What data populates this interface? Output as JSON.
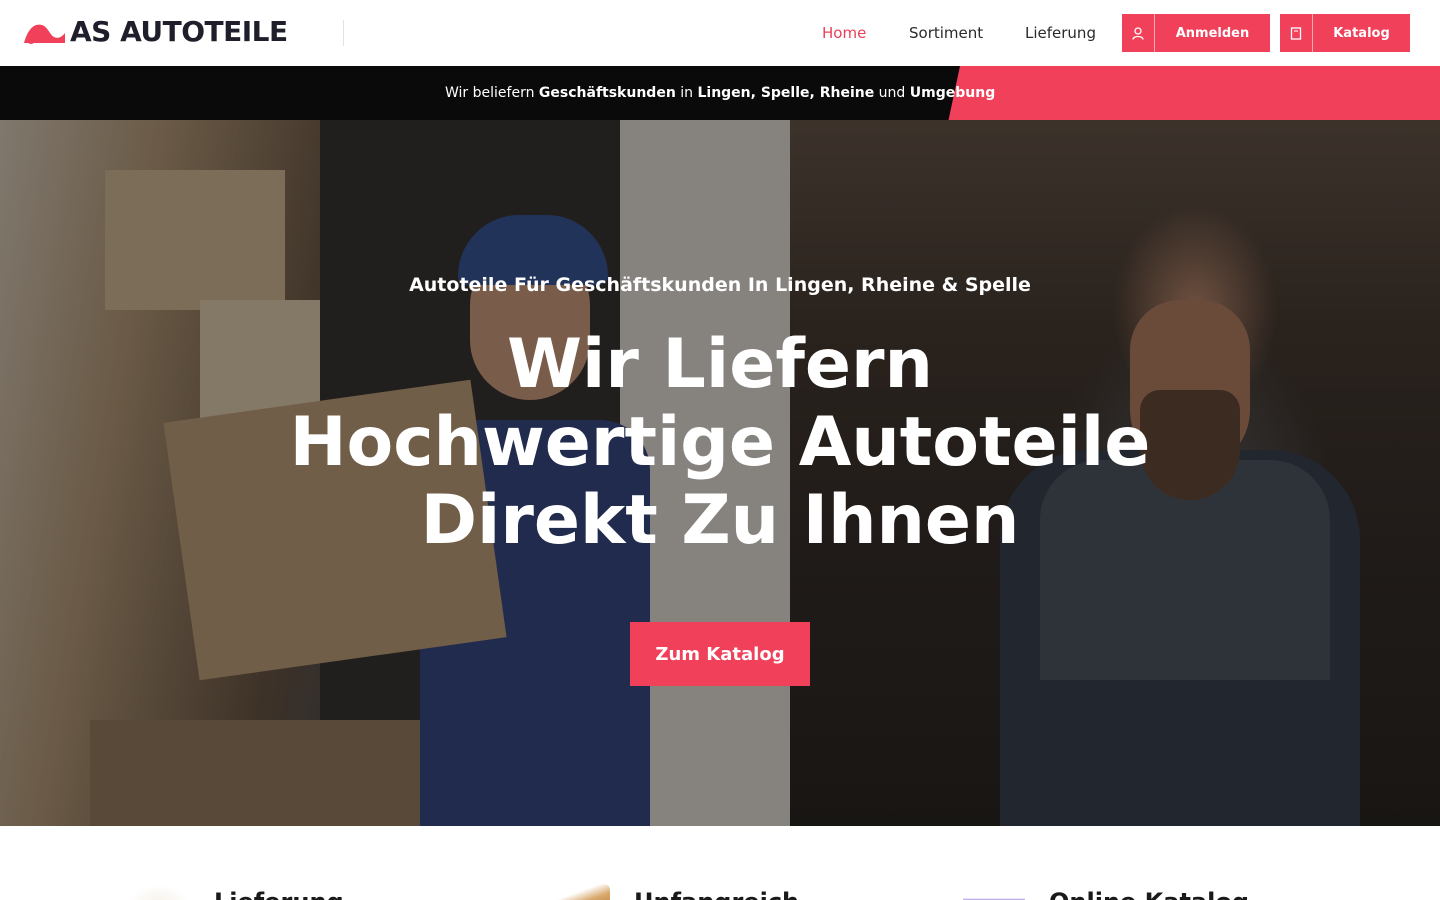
{
  "brand": {
    "name": "AS AUTOTEILE",
    "accent_color": "#f0405a",
    "logo_icon": "car-swoosh-logo-icon"
  },
  "nav": {
    "items": [
      {
        "label": "Home",
        "active": true
      },
      {
        "label": "Sortiment",
        "active": false
      },
      {
        "label": "Lieferung",
        "active": false
      }
    ]
  },
  "header_buttons": {
    "login": {
      "label": "Anmelden",
      "icon": "user-icon"
    },
    "catalog": {
      "label": "Katalog",
      "icon": "book-icon"
    }
  },
  "infobar": {
    "p1": "Wir beliefern ",
    "b1": "Geschäftskunden",
    "p2": " in ",
    "b2": "Lingen, Spelle, Rheine",
    "p3": " und ",
    "b3": "Umgebung"
  },
  "hero": {
    "subtitle": "Autoteile Für Geschäftskunden In Lingen, Rheine & Spelle",
    "title_line1": "Wir Liefern",
    "title_line2": "Hochwertige Autoteile",
    "title_line3": "Direkt Zu Ihnen",
    "cta_label": "Zum Katalog"
  },
  "features": [
    {
      "title": "Lieferung",
      "icon": "delivery-icon"
    },
    {
      "title": "Unfangreich",
      "icon": "package-icon"
    },
    {
      "title": "Online Katalog",
      "icon": "catalog-icon"
    }
  ]
}
